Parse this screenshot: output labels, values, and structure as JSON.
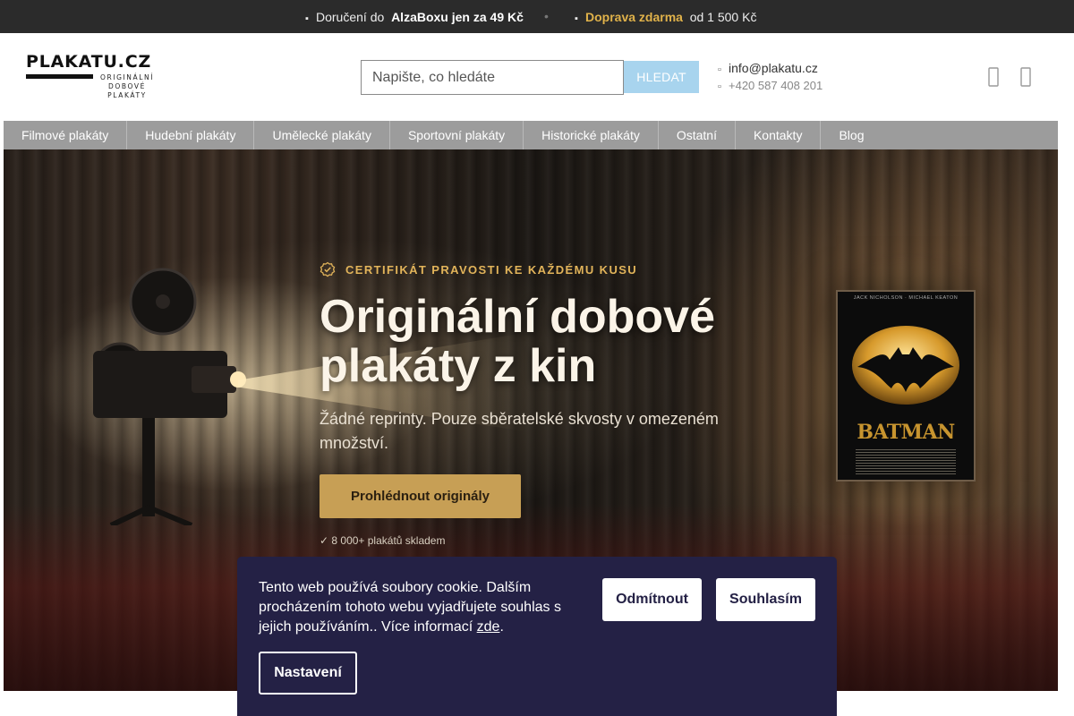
{
  "topbar": {
    "msg1_prefix": "Doručení do",
    "msg1_bold": "AlzaBoxu jen za 49 Kč",
    "separator": "•",
    "msg2_bold": "Doprava zdarma",
    "msg2_suffix": "od 1 500 Kč",
    "icons": [
      "truck-icon",
      "box-icon"
    ]
  },
  "header": {
    "logo_main": "PLAKATU.CZ",
    "logo_sub": [
      "ORIGINÁLNÍ",
      "DOBOVÉ",
      "PLAKÁTY"
    ],
    "search_placeholder": "Napište, co hledáte",
    "search_button": "HLEDAT",
    "email": "info@plakatu.cz",
    "phone": "+420 587 408 201",
    "icons": [
      "user-icon",
      "cart-icon"
    ]
  },
  "nav": {
    "items": [
      "Filmové plakáty",
      "Hudební plakáty",
      "Umělecké plakáty",
      "Sportovní plakáty",
      "Historické plakáty",
      "Ostatní",
      "Kontakty",
      "Blog"
    ]
  },
  "hero": {
    "badge": "CERTIFIKÁT PRAVOSTI KE KAŽDÉMU KUSU",
    "title": "Originální dobové plakáty z kin",
    "subtitle": "Žádné reprinty. Pouze sběratelské skvosty v omezeném množství.",
    "cta": "Prohlédnout originály",
    "stock_note": "✓ 8 000+ plakátů skladem",
    "poster_title": "BATMAN",
    "poster_header": "JACK NICHOLSON · MICHAEL KEATON",
    "accent_color": "#c79f55"
  },
  "cookie": {
    "text_main": "Tento web používá soubory cookie. Dalším procházením tohoto webu vyjadřujete souhlas s jejich používáním.. Více informací ",
    "link": "zde",
    "text_end": ".",
    "reject": "Odmítnout",
    "accept": "Souhlasím",
    "settings": "Nastavení",
    "bg_color": "#242145"
  }
}
